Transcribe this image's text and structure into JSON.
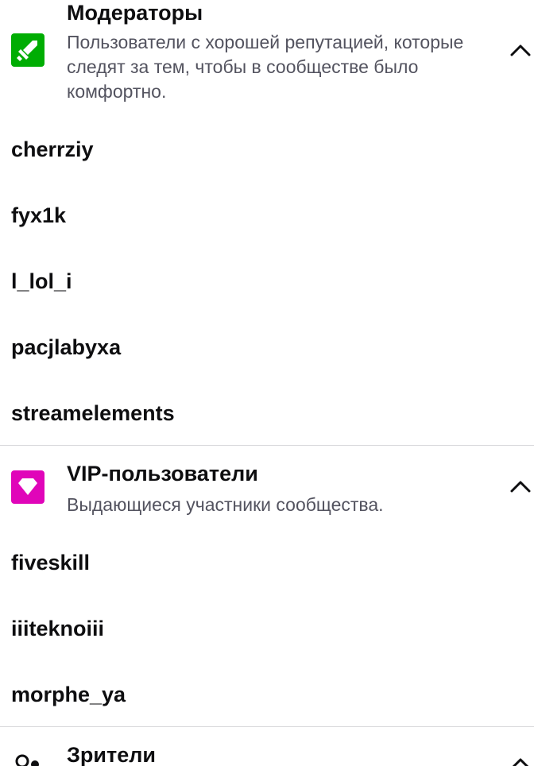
{
  "moderators": {
    "title": "Модераторы",
    "description": "Пользователи с хорошей репутацией, которые следят за тем, чтобы в сообществе было комфортно.",
    "badge_icon": "sword-icon",
    "badge_color": "#00ad03",
    "users": [
      "cherrziy",
      "fyx1k",
      "l_lol_i",
      "pacjlabyxa",
      "streamelements"
    ]
  },
  "vips": {
    "title": "VIP-пользователи",
    "description": "Выдающиеся участники сообщества.",
    "badge_icon": "diamond-icon",
    "badge_color": "#e005b9",
    "users": [
      "fiveskill",
      "iiiteknoiii",
      "morphe_ya"
    ]
  },
  "viewers": {
    "title": "Зрители",
    "icon": "person-icon"
  },
  "colors": {
    "text": "#0e0e10",
    "secondary": "#53535f",
    "divider": "#d9d9dc"
  }
}
